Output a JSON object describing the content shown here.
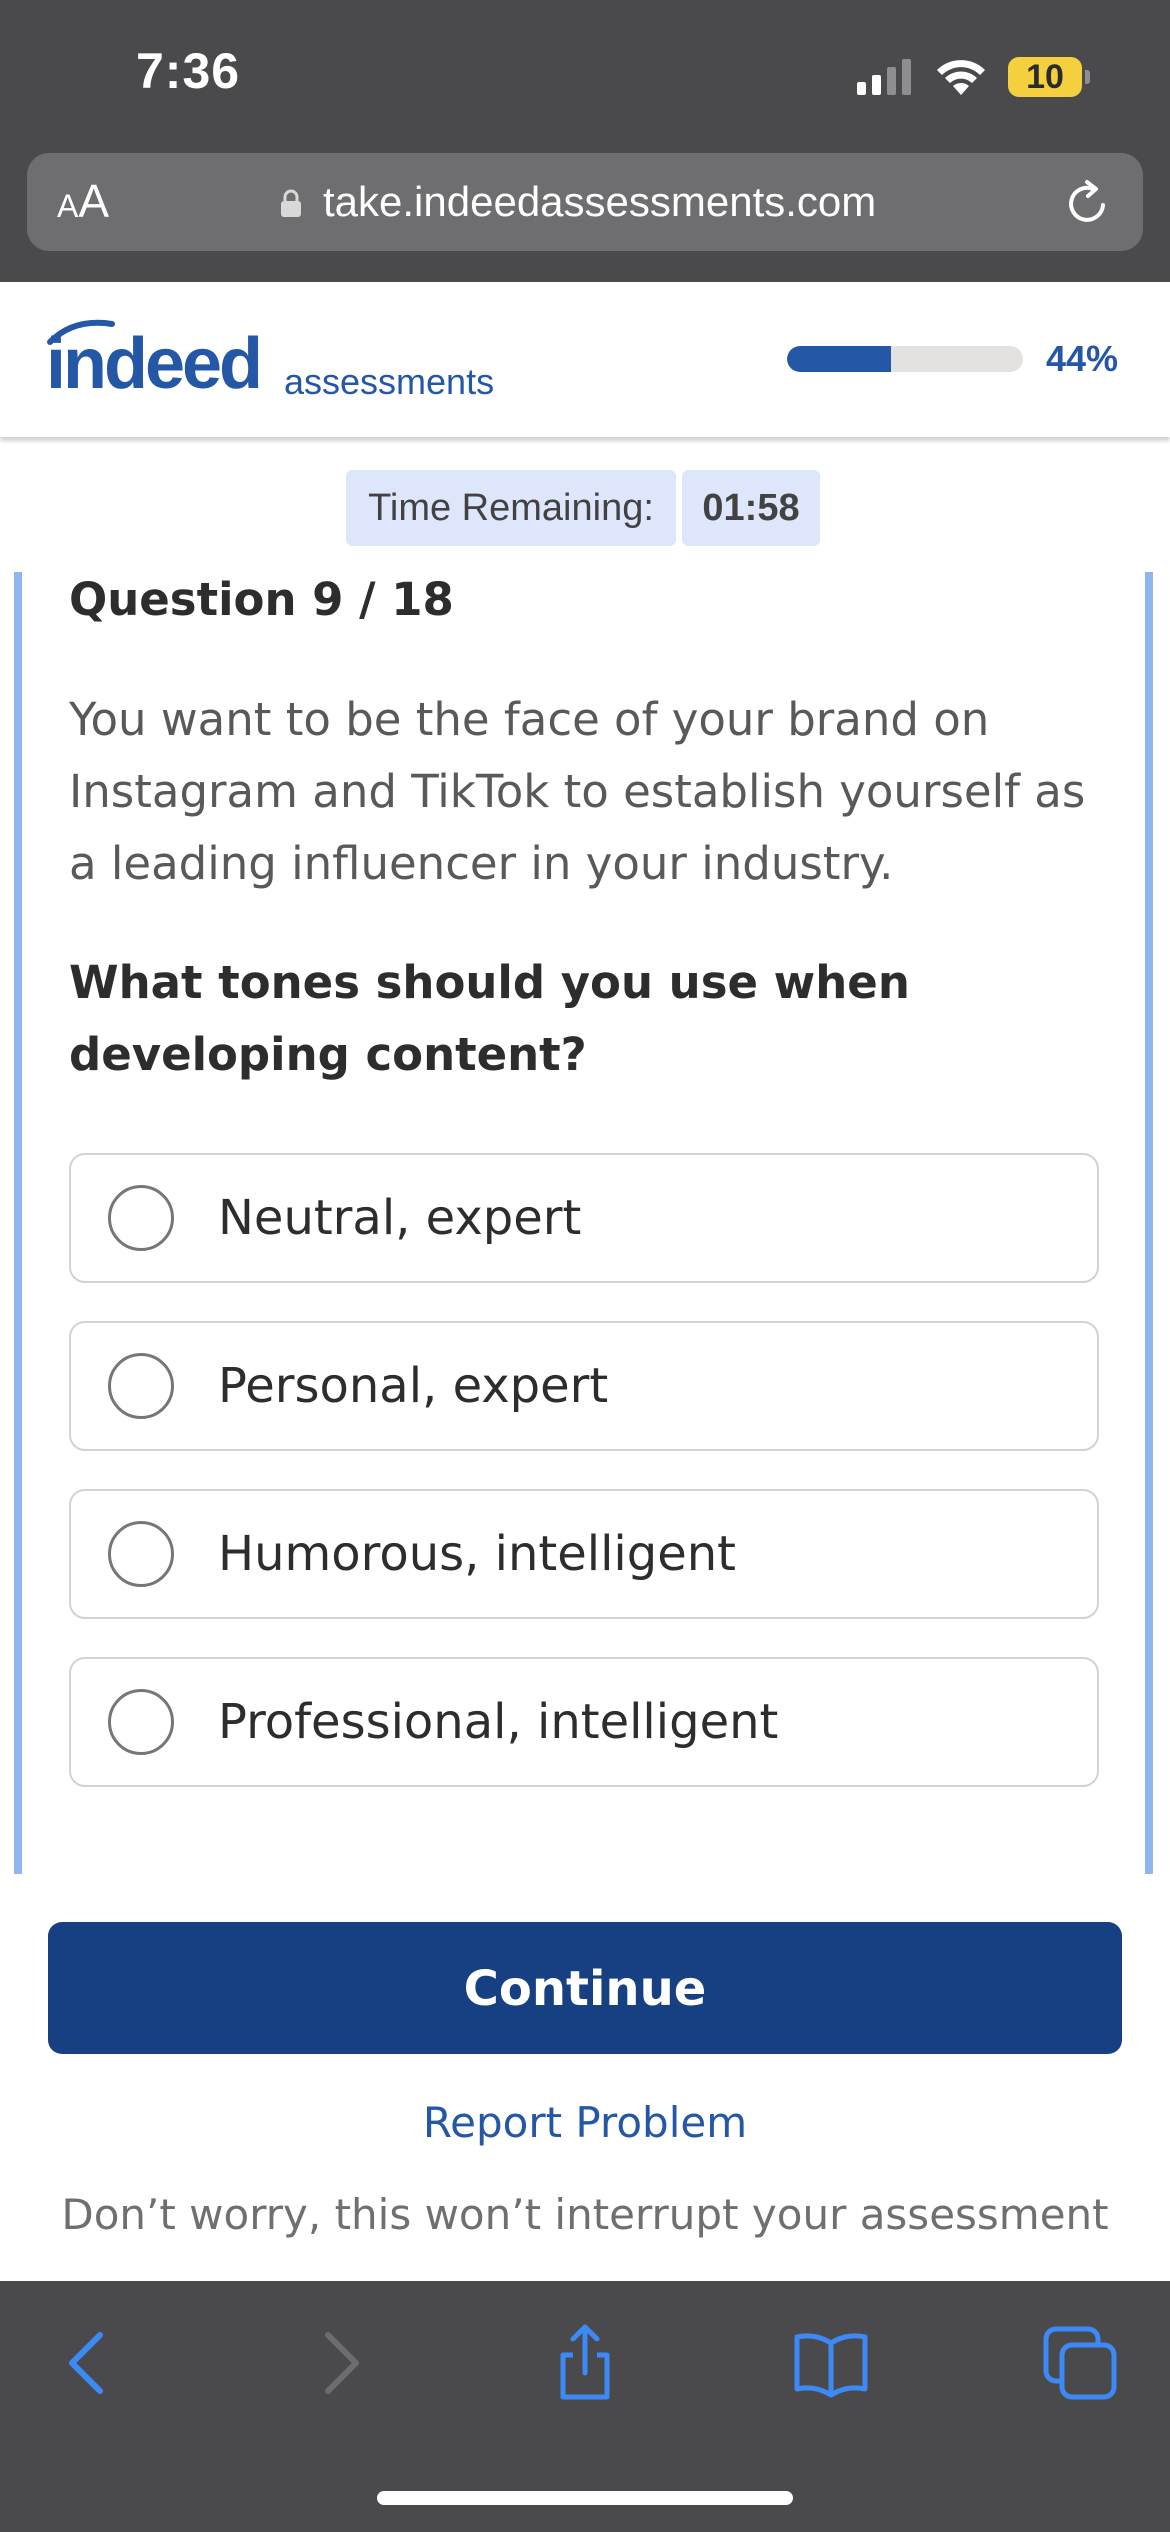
{
  "status_bar": {
    "time": "7:36",
    "battery": "10",
    "battery_color": "#f4d03f"
  },
  "browser": {
    "text_size_small": "A",
    "text_size_large": "A",
    "url": "take.indeedassessments.com"
  },
  "header": {
    "logo_word": "indeed",
    "logo_sub": "assessments",
    "progress_percent_label": "44%",
    "progress_fraction": 0.44,
    "brand_color": "#2557a7"
  },
  "timer": {
    "label": "Time Remaining:",
    "value": "01:58"
  },
  "question": {
    "number_label": "Question 9 / 18",
    "scenario": "You want to be the face of your brand on Instagram and TikTok to establish yourself as a leading influencer in your industry.",
    "prompt": "What tones should you use when developing content?",
    "options": [
      {
        "label": "Neutral, expert",
        "selected": false
      },
      {
        "label": "Personal, expert",
        "selected": false
      },
      {
        "label": "Humorous, intelligent",
        "selected": false
      },
      {
        "label": "Professional, intelligent",
        "selected": false
      }
    ]
  },
  "footer": {
    "continue_label": "Continue",
    "continue_color": "#164081",
    "report_label": "Report Problem",
    "reassurance": "Don’t worry, this won’t interrupt your assessment"
  },
  "toolbar": {
    "icons": [
      "back-icon",
      "forward-icon",
      "share-icon",
      "bookmarks-icon",
      "tabs-icon"
    ],
    "icon_color": "#3d8af7"
  }
}
